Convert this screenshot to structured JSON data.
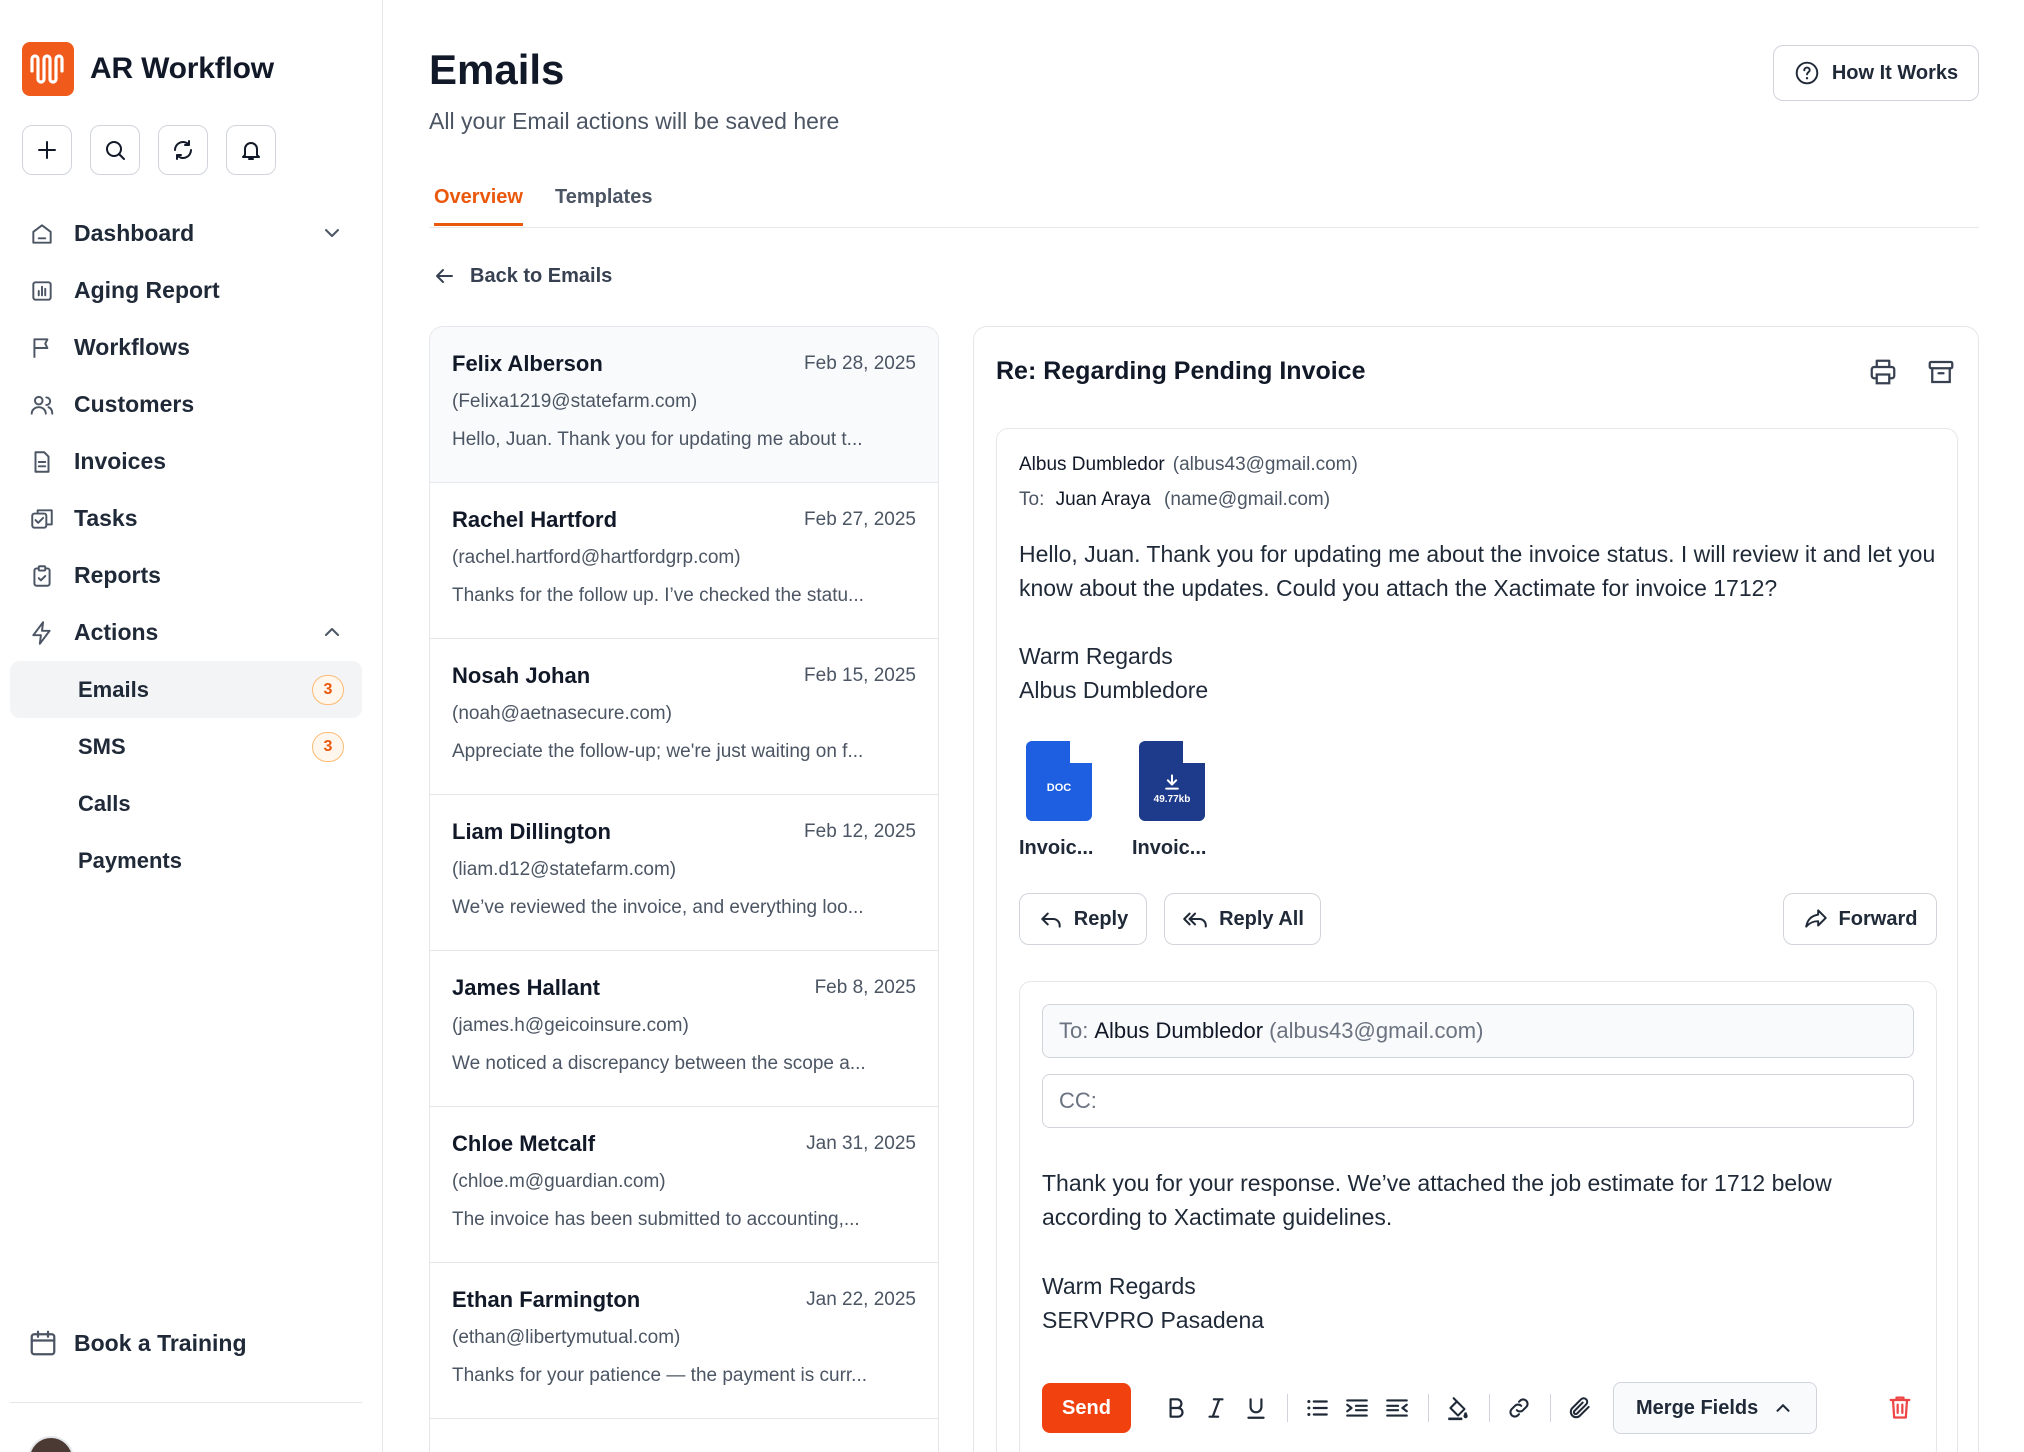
{
  "app": {
    "brand_name": "AR Workflow"
  },
  "sidebar": {
    "nav": [
      {
        "label": "Dashboard",
        "icon": "home-icon"
      },
      {
        "label": "Aging Report",
        "icon": "report-chart-icon"
      },
      {
        "label": "Workflows",
        "icon": "flag-icon"
      },
      {
        "label": "Customers",
        "icon": "users-icon"
      },
      {
        "label": "Invoices",
        "icon": "document-icon"
      },
      {
        "label": "Tasks",
        "icon": "tasks-icon"
      },
      {
        "label": "Reports",
        "icon": "clipboard-icon"
      },
      {
        "label": "Actions",
        "icon": "lightning-icon"
      }
    ],
    "actions_sub": [
      {
        "label": "Emails",
        "badge": "3"
      },
      {
        "label": "SMS",
        "badge": "3"
      },
      {
        "label": "Calls"
      },
      {
        "label": "Payments"
      }
    ],
    "book_training": "Book a Training"
  },
  "header": {
    "title": "Emails",
    "subtitle": "All your Email actions will be saved here",
    "how_it_works": "How It Works",
    "tabs": [
      "Overview",
      "Templates"
    ],
    "back_label": "Back to Emails"
  },
  "emails": [
    {
      "name": "Felix Alberson",
      "date": "Feb 28, 2025",
      "email": "(Felixa1219@statefarm.com)",
      "preview": "Hello, Juan. Thank you for updating me about t..."
    },
    {
      "name": "Rachel Hartford",
      "date": "Feb 27, 2025",
      "email": "(rachel.hartford@hartfordgrp.com)",
      "preview": "Thanks for the follow up. I’ve checked the statu..."
    },
    {
      "name": "Nosah Johan",
      "date": "Feb 15, 2025",
      "email": "(noah@aetnasecure.com)",
      "preview": "Appreciate the follow-up; we're just waiting on f..."
    },
    {
      "name": "Liam Dillington",
      "date": "Feb 12, 2025",
      "email": "(liam.d12@statefarm.com)",
      "preview": "We’ve reviewed the invoice, and everything loo..."
    },
    {
      "name": "James Hallant",
      "date": "Feb 8, 2025",
      "email": "(james.h@geicoinsure.com)",
      "preview": "We noticed a discrepancy between the scope a..."
    },
    {
      "name": "Chloe Metcalf",
      "date": "Jan 31, 2025",
      "email": "(chloe.m@guardian.com)",
      "preview": "The invoice has been submitted to accounting,..."
    },
    {
      "name": "Ethan Farmington",
      "date": "Jan 22, 2025",
      "email": "(ethan@libertymutual.com)",
      "preview": "Thanks for your patience — the payment is curr..."
    }
  ],
  "detail": {
    "subject": "Re: Regarding Pending Invoice",
    "from_name": "Albus Dumbledor",
    "from_email": "(albus43@gmail.com)",
    "to_prefix": "To:",
    "to_name": "Juan Araya",
    "to_email": "(name@gmail.com)",
    "body": "Hello, Juan. Thank you for updating me about the invoice status. I will review it and let you know about the updates. Could you attach the Xactimate for invoice 1712?",
    "sign_1": "Warm Regards",
    "sign_2": "Albus Dumbledore",
    "attachments": [
      {
        "badge": "DOC",
        "name": "Invoic...",
        "color": "#1d5fe0"
      },
      {
        "badge": "49.77kb",
        "name": "Invoic...",
        "color": "#1e3a8a"
      }
    ],
    "reply_label": "Reply",
    "reply_all_label": "Reply All",
    "forward_label": "Forward"
  },
  "composer": {
    "to_prefix": "To:",
    "to_name": "Albus Dumbledor",
    "to_email": "(albus43@gmail.com)",
    "cc_label": "CC:",
    "body": "Thank you for your response. We’ve attached the job estimate for 1712 below according to Xactimate guidelines.",
    "sign_1": "Warm Regards",
    "sign_2": "SERVPRO Pasadena",
    "send_label": "Send",
    "merge_fields_label": "Merge Fields"
  },
  "colors": {
    "accent": "#ea580c",
    "send": "#f0410f",
    "brand": "#f05a1a"
  }
}
